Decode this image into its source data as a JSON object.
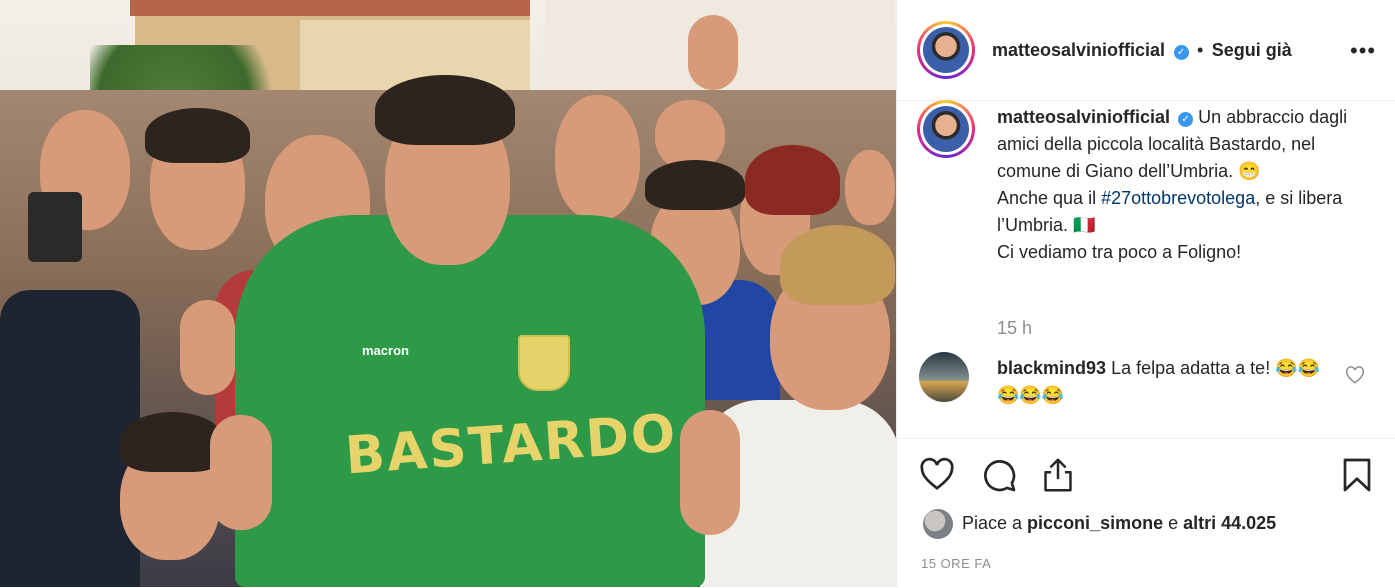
{
  "post": {
    "photo": {
      "hoodie_text": "BASTARDO",
      "brand_text": "macron"
    },
    "header": {
      "username": "matteosalviniofficial",
      "separator": "•",
      "follow_label": "Segui già",
      "more_icon": "more-horizontal-icon",
      "verified_icon": "verified-badge-icon"
    },
    "caption": {
      "username": "matteosalviniofficial",
      "text_1": "Un abbraccio dagli amici della piccola località Bastardo, nel comune di Giano dell’Umbria. 😁",
      "text_2_pre": "Anche qua il ",
      "hashtag": "#27ottobrevotolega",
      "text_2_post": ", e si libera l’Umbria. 🇮🇹",
      "text_3": "Ci vediamo tra poco a Foligno!",
      "relative_time": "15 h"
    },
    "comments": [
      {
        "username": "blackmind93",
        "text": "La felpa adatta a te! 😂😂😂😂😂"
      }
    ],
    "actions": {
      "like_icon": "heart-icon",
      "comment_icon": "comment-icon",
      "share_icon": "share-icon",
      "save_icon": "bookmark-icon"
    },
    "likes": {
      "prefix": "Piace a ",
      "user": "picconi_simone",
      "middle": " e ",
      "others": "altri 44.025"
    },
    "timestamp": "15 ORE FA",
    "colors": {
      "link": "#00376b",
      "verified": "#3897f0",
      "secondary_text": "#8e8e8e",
      "hoodie": "#2e9a47"
    }
  }
}
